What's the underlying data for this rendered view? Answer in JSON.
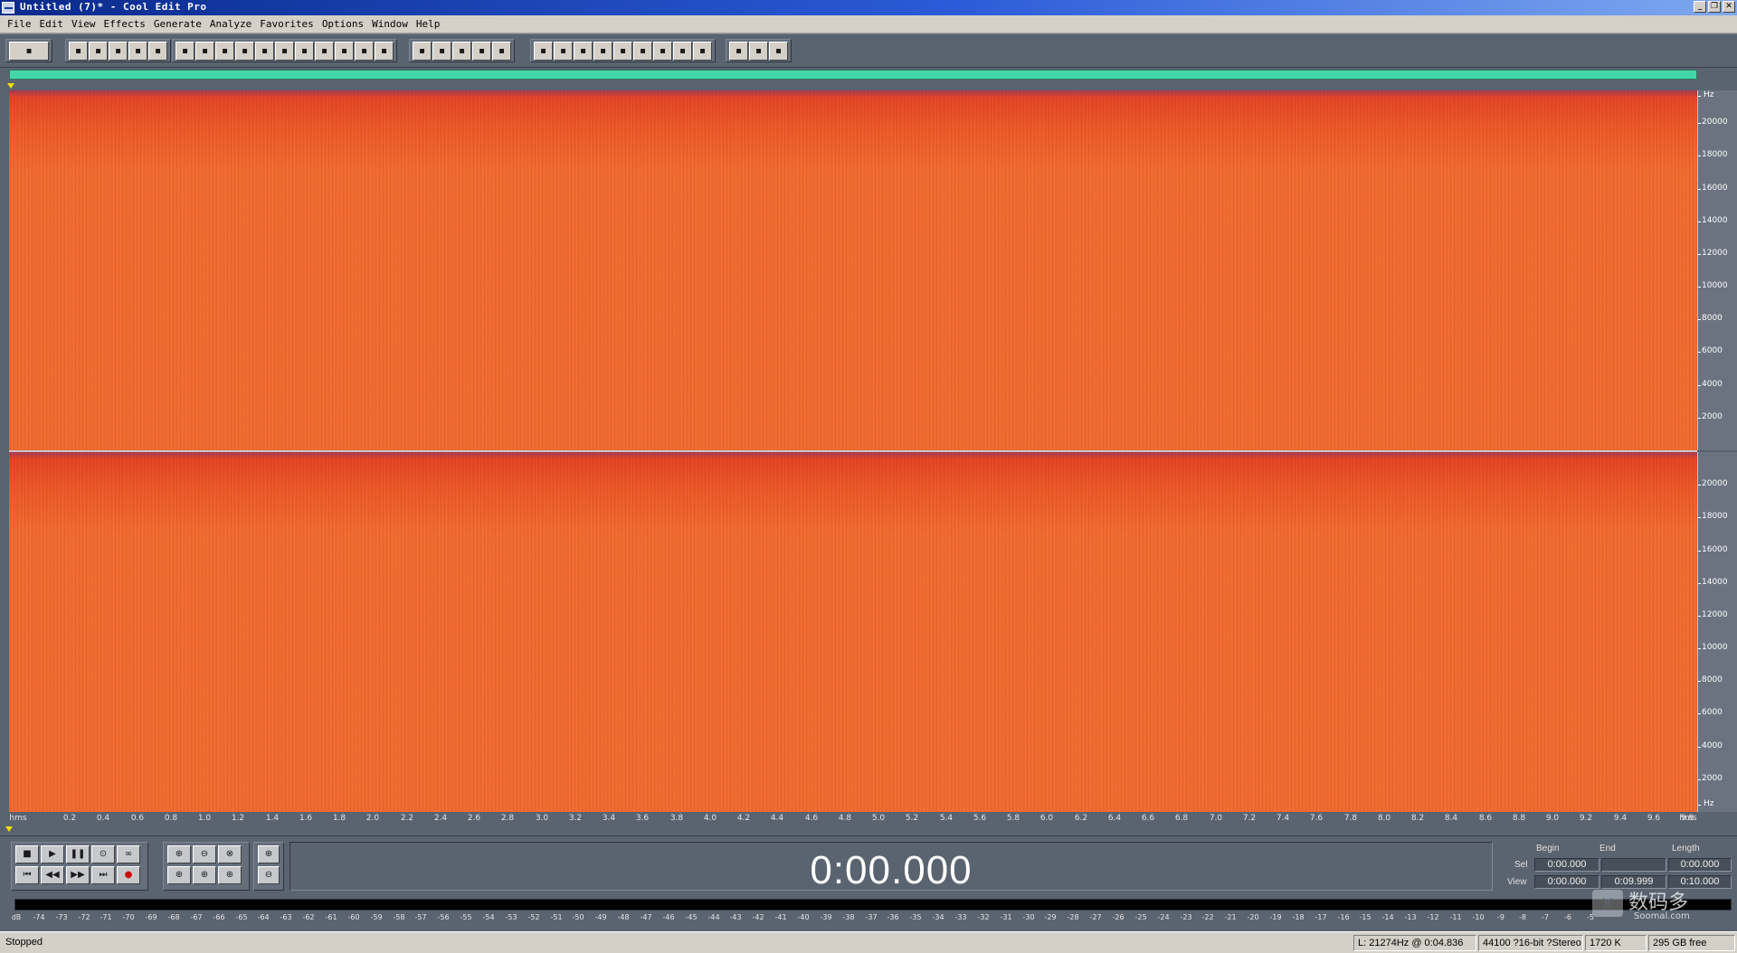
{
  "window": {
    "title": "Untitled (7)* - Cool Edit Pro",
    "controls": [
      "_",
      "❐",
      "✕"
    ]
  },
  "menu": [
    "File",
    "Edit",
    "View",
    "Effects",
    "Generate",
    "Analyze",
    "Favorites",
    "Options",
    "Window",
    "Help"
  ],
  "toolbar": {
    "groups": [
      [
        {
          "icon": "multitrack-toggle-icon"
        }
      ],
      [
        {
          "icon": "new-file-icon"
        },
        {
          "icon": "open-file-icon"
        },
        {
          "icon": "save-icon"
        },
        {
          "icon": "save-all-icon"
        },
        {
          "icon": "close-file-icon"
        }
      ],
      [
        {
          "icon": "undo-icon"
        },
        {
          "icon": "redo-icon"
        },
        {
          "icon": "repeat-last-icon"
        },
        {
          "icon": "copy-new-icon"
        },
        {
          "icon": "copy-icon"
        },
        {
          "icon": "cut-icon"
        },
        {
          "icon": "paste-icon"
        },
        {
          "icon": "paste-new-icon"
        },
        {
          "icon": "mix-paste-icon"
        },
        {
          "icon": "trim-icon"
        },
        {
          "icon": "cue-icon"
        }
      ],
      [
        {
          "icon": "waveform-view-icon"
        },
        {
          "icon": "spectral-view-icon"
        },
        {
          "icon": "edit-left-icon"
        },
        {
          "icon": "edit-both-icon"
        },
        {
          "icon": "edit-right-icon"
        }
      ],
      [
        {
          "icon": "info-icon"
        },
        {
          "icon": "mark-icon"
        },
        {
          "icon": "snap-icon"
        },
        {
          "icon": "play-cue-icon"
        },
        {
          "icon": "zoom-tool-icon"
        },
        {
          "icon": "frequency-analysis-icon"
        },
        {
          "icon": "statistics-icon"
        },
        {
          "icon": "sample-format-icon"
        },
        {
          "icon": "blank-icon"
        }
      ],
      [
        {
          "icon": "settings-icon"
        },
        {
          "icon": "script-icon"
        },
        {
          "icon": "help-icon"
        }
      ]
    ]
  },
  "hz_ruler": {
    "unit": "Hz",
    "ticks": [
      "20000",
      "18000",
      "16000",
      "14000",
      "12000",
      "10000",
      "8000",
      "6000",
      "4000",
      "2000"
    ]
  },
  "time_ruler": {
    "unit": "hms",
    "ticks": [
      "0.2",
      "0.4",
      "0.6",
      "0.8",
      "1.0",
      "1.2",
      "1.4",
      "1.6",
      "1.8",
      "2.0",
      "2.2",
      "2.4",
      "2.6",
      "2.8",
      "3.0",
      "3.2",
      "3.4",
      "3.6",
      "3.8",
      "4.0",
      "4.2",
      "4.4",
      "4.6",
      "4.8",
      "5.0",
      "5.2",
      "5.4",
      "5.6",
      "5.8",
      "6.0",
      "6.2",
      "6.4",
      "6.6",
      "6.8",
      "7.0",
      "7.2",
      "7.4",
      "7.6",
      "7.8",
      "8.0",
      "8.2",
      "8.4",
      "8.6",
      "8.8",
      "9.0",
      "9.2",
      "9.4",
      "9.6",
      "9.8"
    ]
  },
  "transport": {
    "row1": [
      {
        "icon": "stop-icon",
        "glyph": "■"
      },
      {
        "icon": "play-icon",
        "glyph": "▶"
      },
      {
        "icon": "pause-icon",
        "glyph": "❚❚"
      },
      {
        "icon": "play-to-end-icon",
        "glyph": "⊙"
      },
      {
        "icon": "loop-icon",
        "glyph": "∞"
      }
    ],
    "row2": [
      {
        "icon": "go-to-start-icon",
        "glyph": "⏮"
      },
      {
        "icon": "rewind-icon",
        "glyph": "◀◀"
      },
      {
        "icon": "fast-forward-icon",
        "glyph": "▶▶"
      },
      {
        "icon": "go-to-end-icon",
        "glyph": "⏭"
      },
      {
        "icon": "record-icon",
        "glyph": "●"
      }
    ],
    "zoom_row1": [
      {
        "icon": "zoom-in-horizontal-icon",
        "glyph": "⊕"
      },
      {
        "icon": "zoom-out-horizontal-icon",
        "glyph": "⊖"
      },
      {
        "icon": "zoom-out-full-icon",
        "glyph": "⊗"
      }
    ],
    "zoom_row2": [
      {
        "icon": "zoom-to-left-icon",
        "glyph": "⊕"
      },
      {
        "icon": "zoom-to-right-icon",
        "glyph": "⊕"
      },
      {
        "icon": "zoom-selection-icon",
        "glyph": "⊕"
      }
    ],
    "vzoom": [
      {
        "icon": "zoom-in-vertical-icon",
        "glyph": "⊕"
      },
      {
        "icon": "zoom-out-vertical-icon",
        "glyph": "⊖"
      }
    ]
  },
  "time_display": "0:00.000",
  "selview": {
    "headers": {
      "begin": "Begin",
      "end": "End",
      "length": "Length"
    },
    "sel": {
      "label": "Sel",
      "begin": "0:00.000",
      "end": "",
      "length": "0:00.000"
    },
    "view": {
      "label": "View",
      "begin": "0:00.000",
      "end": "0:09.999",
      "length": "0:10.000"
    }
  },
  "meter": {
    "ticks": [
      "dB",
      "-74",
      "-73",
      "-72",
      "-71",
      "-70",
      "-69",
      "-68",
      "-67",
      "-66",
      "-65",
      "-64",
      "-63",
      "-62",
      "-61",
      "-60",
      "-59",
      "-58",
      "-57",
      "-56",
      "-55",
      "-54",
      "-53",
      "-52",
      "-51",
      "-50",
      "-49",
      "-48",
      "-47",
      "-46",
      "-45",
      "-44",
      "-43",
      "-42",
      "-41",
      "-40",
      "-39",
      "-38",
      "-37",
      "-36",
      "-35",
      "-34",
      "-33",
      "-32",
      "-31",
      "-30",
      "-29",
      "-28",
      "-27",
      "-26",
      "-25",
      "-24",
      "-23",
      "-22",
      "-21",
      "-20",
      "-19",
      "-18",
      "-17",
      "-16",
      "-15",
      "-14",
      "-13",
      "-12",
      "-11",
      "-10",
      "-9",
      "-8",
      "-7",
      "-6",
      "-5"
    ]
  },
  "watermark": {
    "logo": "✕",
    "text": "数码多",
    "sub": "Soomal.com"
  },
  "status": {
    "state": "Stopped",
    "cursor": "L: 21274Hz @   0:04.836",
    "format": "44100 ?16-bit ?Stereo",
    "size": "1720 K",
    "free": "295 GB free"
  },
  "colors": {
    "overview": "#43d6a6",
    "spectrum": "#f06a2e",
    "panel": "#5a6370"
  }
}
